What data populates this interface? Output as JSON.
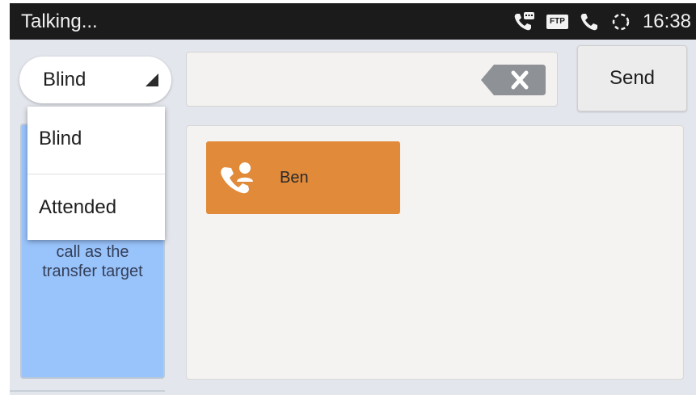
{
  "statusbar": {
    "title": "Talking...",
    "ftp_label": "FTP",
    "time": "16:38",
    "icons": [
      "voicemail-phone-icon",
      "ftp-icon",
      "phone-icon",
      "loading-icon"
    ]
  },
  "transfer": {
    "mode_selected": "Blind",
    "modes": [
      "Blind",
      "Attended"
    ],
    "number_value": "",
    "send_label": "Send",
    "hint_lines": [
      "call as the",
      "transfer target"
    ]
  },
  "contacts": [
    {
      "name": "Ben",
      "icon": "call-contact-icon"
    }
  ],
  "colors": {
    "statusbar_bg": "#1b1b1b",
    "screen_bg": "#e3e6ec",
    "hint_panel_bg": "#99c3fb",
    "contact_card_bg": "#e18a3a"
  }
}
